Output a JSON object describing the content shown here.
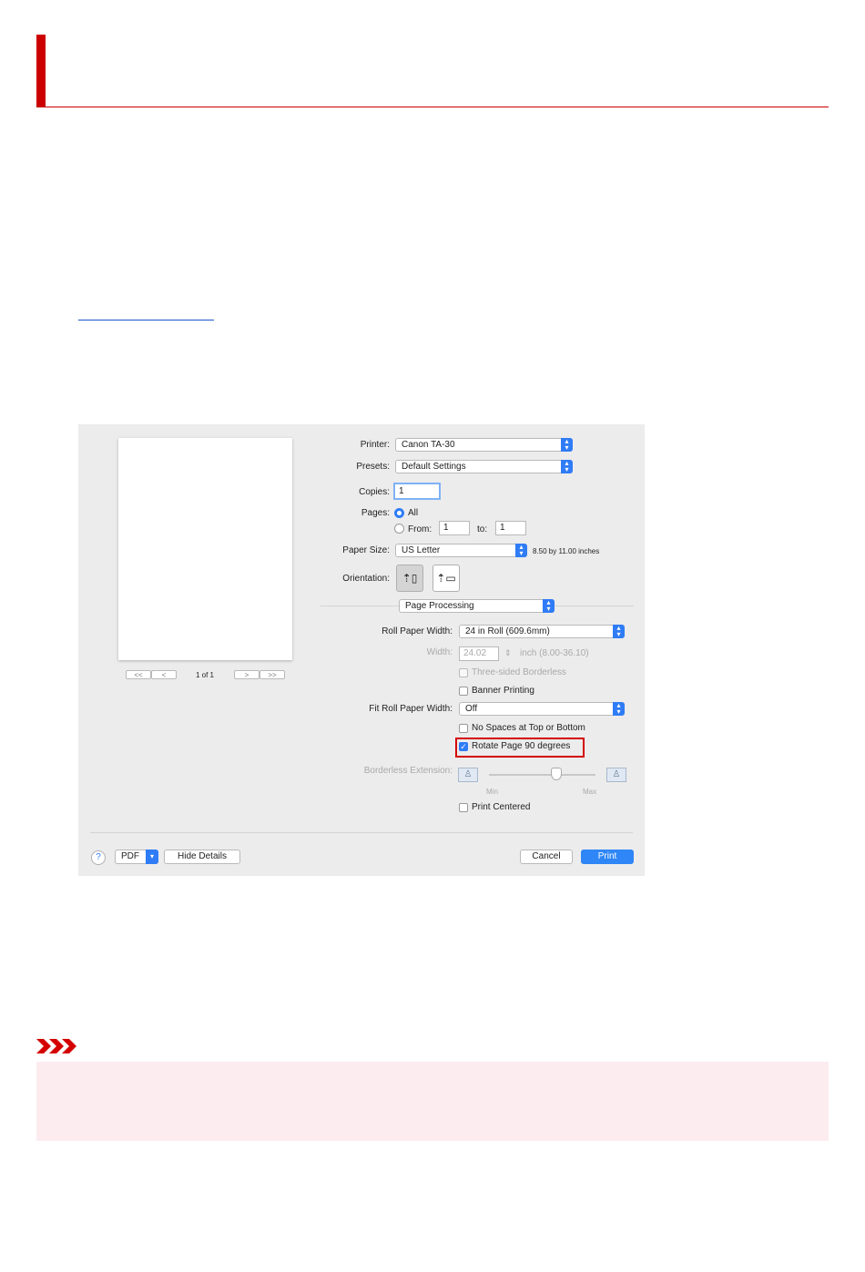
{
  "dialog": {
    "printer": {
      "label": "Printer:",
      "value": "Canon TA-30"
    },
    "presets": {
      "label": "Presets:",
      "value": "Default Settings"
    },
    "copies": {
      "label": "Copies:",
      "value": "1"
    },
    "pages": {
      "label": "Pages:",
      "all": "All",
      "from_label": "From:",
      "from_value": "1",
      "to_label": "to:",
      "to_value": "1"
    },
    "paper_size": {
      "label": "Paper Size:",
      "value": "US Letter",
      "dimensions": "8.50 by 11.00 inches"
    },
    "orientation": {
      "label": "Orientation:",
      "portrait_glyph": "⇡▯",
      "landscape_glyph": "⇡▭"
    },
    "preview_nav": {
      "first": "<<",
      "prev": "<",
      "page": "1 of 1",
      "next": ">",
      "last": ">>"
    },
    "section": {
      "value": "Page Processing"
    },
    "roll_paper_width": {
      "label": "Roll Paper Width:",
      "value": "24 in Roll (609.6mm)"
    },
    "width": {
      "label": "Width:",
      "value": "24.02",
      "unit": "inch (8.00-36.10)"
    },
    "three_sided_borderless": {
      "label": "Three-sided Borderless",
      "checked": false
    },
    "banner_printing": {
      "label": "Banner Printing",
      "checked": false
    },
    "fit_roll_paper_width": {
      "label": "Fit Roll Paper Width:",
      "value": "Off"
    },
    "no_spaces": {
      "label": "No Spaces at Top or Bottom",
      "checked": false
    },
    "rotate_page": {
      "label": "Rotate Page 90 degrees",
      "checked": true
    },
    "borderless_extension": {
      "label": "Borderless Extension:",
      "min": "Min",
      "max": "Max"
    },
    "print_centered": {
      "label": "Print Centered",
      "checked": false
    },
    "footer": {
      "help": "?",
      "pdf": "PDF",
      "hide_details": "Hide Details",
      "cancel": "Cancel",
      "print": "Print"
    }
  },
  "colors": {
    "accent": "#cc0000",
    "highlight": "#d40000",
    "mac_blue": "#2f7cf6",
    "note_bg": "#fcecef"
  }
}
